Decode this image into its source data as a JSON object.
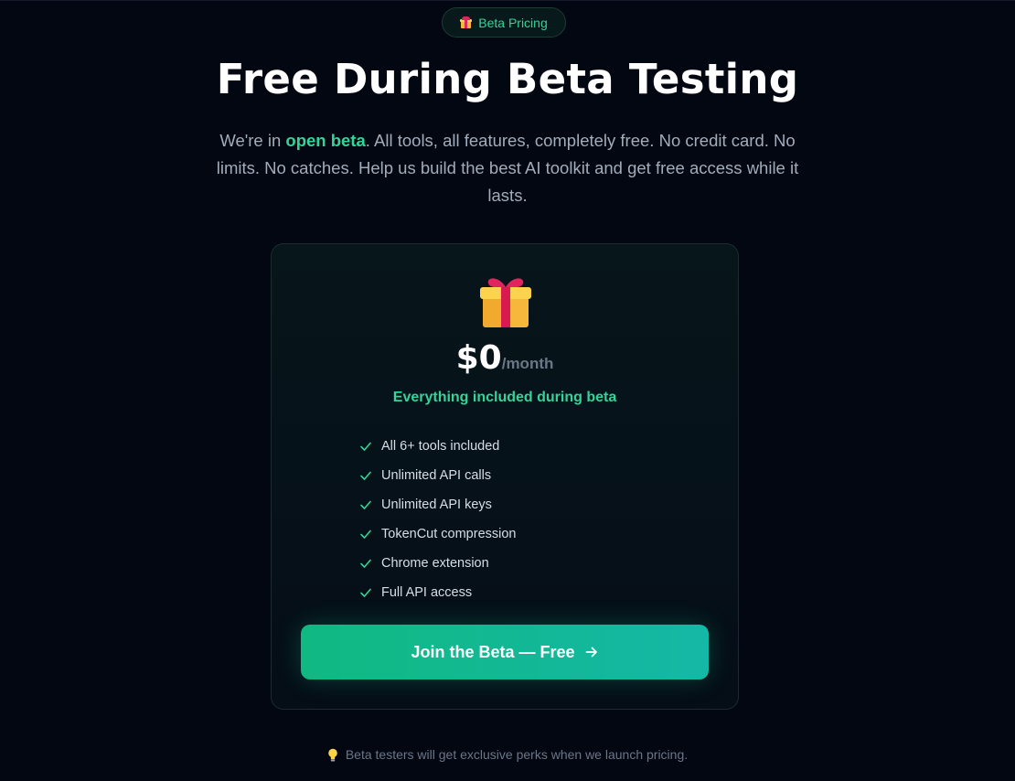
{
  "badge": {
    "label": "Beta Pricing",
    "icon": "gift-icon"
  },
  "hero": {
    "title": "Free During Beta Testing",
    "subtitle_pre": "We're in ",
    "subtitle_highlight": "open beta",
    "subtitle_post": ". All tools, all features, completely free. No credit card. No limits. No catches. Help us build the best AI toolkit and get free access while it lasts."
  },
  "plan": {
    "icon": "gift-icon",
    "price": "$0",
    "period": "/month",
    "tagline": "Everything included during beta",
    "features": [
      "All 6+ tools included",
      "Unlimited API calls",
      "Unlimited API keys",
      "TokenCut compression",
      "Chrome extension",
      "Full API access"
    ],
    "cta_label": "Join the Beta — Free",
    "cta_icon": "arrow-right-icon"
  },
  "footer": {
    "icon": "lightbulb-icon",
    "note": "Beta testers will get exclusive perks when we launch pricing."
  },
  "colors": {
    "background": "#030711",
    "accent": "#34d399",
    "button_start": "#10b981",
    "button_end": "#14b8a6"
  }
}
